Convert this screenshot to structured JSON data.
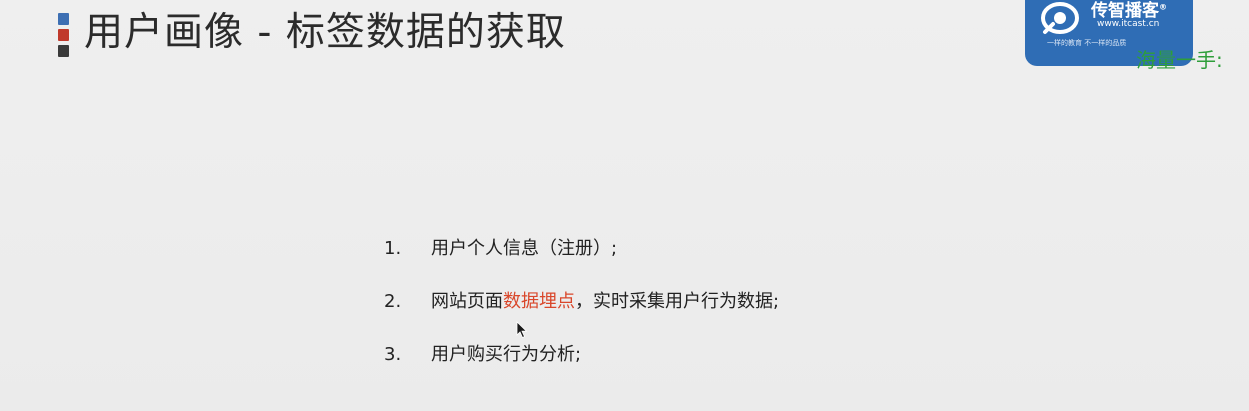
{
  "slide": {
    "title": "用户画像 - 标签数据的获取",
    "accent_colors": [
      "#3d6fb3",
      "#c0392b",
      "#3a3a3a"
    ],
    "highlight_color": "#d9472b"
  },
  "logo": {
    "brand": "传智播客",
    "registered_mark": "®",
    "url": "www.itcast.cn",
    "slogan": "一样的教育 不一样的品质",
    "background_color": "#2f6db5",
    "icon": "itcast-logo-icon"
  },
  "overlay": {
    "text": "海量一手:",
    "color": "#2e9e3a"
  },
  "list": {
    "items": [
      {
        "number": "1.",
        "before": "用户个人信息（注册）;",
        "highlight": "",
        "after": ""
      },
      {
        "number": "2.",
        "before": "网站页面",
        "highlight": "数据埋点",
        "after": "，实时采集用户行为数据;"
      },
      {
        "number": "3.",
        "before": "用户购买行为分析;",
        "highlight": "",
        "after": ""
      }
    ]
  },
  "cursor": {
    "icon": "mouse-pointer-icon"
  }
}
